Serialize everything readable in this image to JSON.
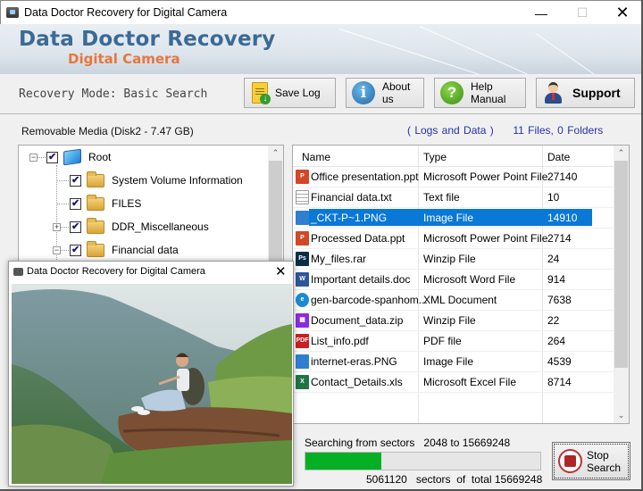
{
  "window": {
    "title": "Data Doctor Recovery for Digital Camera",
    "minimize_icon": "minimize-icon",
    "maximize_icon": "maximize-icon",
    "close_icon": "close-icon",
    "minimize_glyph": "—",
    "maximize_glyph": "☐",
    "close_glyph": "✕"
  },
  "banner": {
    "brand_line1": "Data Doctor Recovery",
    "brand_line2": "Digital Camera"
  },
  "toolbar": {
    "mode_label": "Recovery Mode: Basic Search",
    "buttons": [
      {
        "label": "Save Log",
        "icon": "save-log-icon"
      },
      {
        "label": "About us",
        "icon": "info-icon",
        "glyph": "i"
      },
      {
        "label": "Help Manual",
        "icon": "help-icon",
        "glyph": "?"
      },
      {
        "label": "Support",
        "icon": "support-person-icon"
      }
    ]
  },
  "left_panel": {
    "media_label": "Removable Media (Disk2 - 7.47 GB)",
    "tree": [
      {
        "label": "Root",
        "icon": "computer-icon",
        "checked": true,
        "expander": "−"
      },
      {
        "label": "System Volume Information",
        "icon": "folder-icon",
        "checked": true
      },
      {
        "label": "FILES",
        "icon": "folder-icon",
        "checked": true
      },
      {
        "label": "DDR_Miscellaneous",
        "icon": "folder-icon",
        "checked": true,
        "expander": "+"
      },
      {
        "label": "Financial data",
        "icon": "folder-icon",
        "checked": true,
        "expander": "−"
      }
    ],
    "scroll_up": "⌃"
  },
  "preview": {
    "title": "Data Doctor Recovery for Digital Camera",
    "close_glyph": "✕",
    "image_description": "Woman with backpack sitting on a rock ledge overlooking green mountains"
  },
  "file_list": {
    "info_link": "( Logs and Data )",
    "summary": "11 Files, 0 Folders",
    "columns": [
      "Name",
      "Type",
      "Date"
    ],
    "rows": [
      {
        "name": "Office presentation.ppt",
        "type": "Microsoft Power Point File",
        "date": "27140",
        "icon": "ppt-icon",
        "selected": false
      },
      {
        "name": "Financial data.txt",
        "type": "Text file",
        "date": "10",
        "icon": "text-file-icon",
        "selected": false
      },
      {
        "name": "_CKT-P~1.PNG",
        "type": "Image File",
        "date": "14910",
        "icon": "image-file-icon",
        "selected": true
      },
      {
        "name": "Processed Data.ppt",
        "type": "Microsoft Power Point File",
        "date": "2714",
        "icon": "ppt-icon",
        "selected": false
      },
      {
        "name": "My_files.rar",
        "type": "Winzip File",
        "date": "24",
        "icon": "photoshop-icon",
        "selected": false
      },
      {
        "name": "Important details.doc",
        "type": "Microsoft Word File",
        "date": "914",
        "icon": "word-icon",
        "selected": false
      },
      {
        "name": "gen-barcode-spanhom...",
        "type": "XML Document",
        "date": "7638",
        "icon": "edge-icon",
        "selected": false
      },
      {
        "name": "Document_data.zip",
        "type": "Winzip File",
        "date": "22",
        "icon": "winrar-icon",
        "selected": false
      },
      {
        "name": "List_info.pdf",
        "type": "PDF file",
        "date": "264",
        "icon": "pdf-icon",
        "selected": false
      },
      {
        "name": "internet-eras.PNG",
        "type": "Image File",
        "date": "4539",
        "icon": "image-file-icon",
        "selected": false
      },
      {
        "name": "Contact_Details.xls",
        "type": "Microsoft Excel File",
        "date": "8714",
        "icon": "excel-icon",
        "selected": false
      }
    ],
    "scroll_up": "⌃",
    "scroll_down": "⌄"
  },
  "progress": {
    "search_label": "Searching from sectors",
    "range_text": "2048 to 15669248",
    "current_sectors": "5061120",
    "total_text": "sectors  of  total 15669248",
    "fraction": 0.323,
    "bar_color": "#06b025"
  },
  "stop_button": {
    "line1": "Stop",
    "line2": "Search",
    "icon": "stop-icon"
  },
  "colors": {
    "brand_blue": "#3b6a96",
    "brand_orange": "#e8763d",
    "selection": "#0a78d7",
    "link_blue": "#2233aa"
  }
}
